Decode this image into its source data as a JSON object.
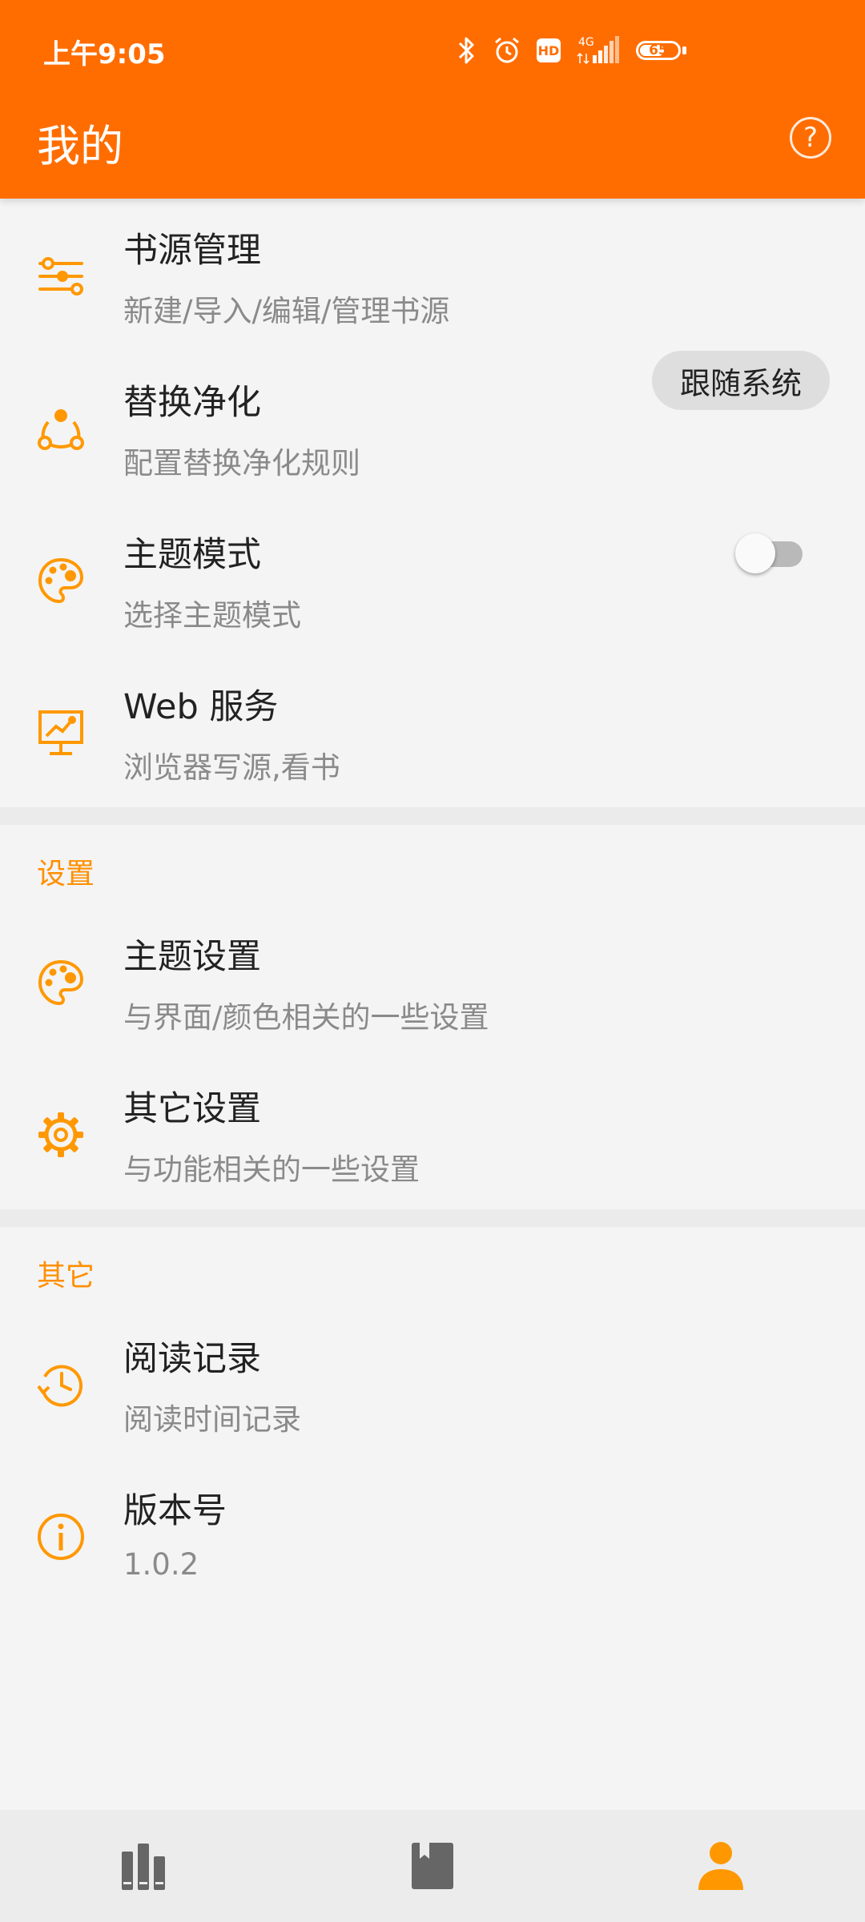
{
  "status_bar": {
    "time": "上午9:05",
    "hd": "HD",
    "network": "4G",
    "battery": "65"
  },
  "app_bar": {
    "title": "我的",
    "help_icon": "help-circle-icon"
  },
  "main_items": [
    {
      "title": "书源管理",
      "summary": "新建/导入/编辑/管理书源",
      "icon": "sliders-icon"
    },
    {
      "title": "替换净化",
      "summary": "配置替换净化规则",
      "icon": "share-triangle-icon"
    },
    {
      "title": "主题模式",
      "summary": "选择主题模式",
      "icon": "palette-icon"
    },
    {
      "title": "Web 服务",
      "summary": "浏览器写源,看书",
      "icon": "presentation-icon"
    }
  ],
  "theme_mode_value": "跟随系统",
  "web_service_enabled": false,
  "settings_section": {
    "header": "设置",
    "items": [
      {
        "title": "主题设置",
        "summary": "与界面/颜色相关的一些设置",
        "icon": "palette-icon"
      },
      {
        "title": "其它设置",
        "summary": "与功能相关的一些设置",
        "icon": "gear-icon"
      }
    ]
  },
  "other_section": {
    "header": "其它",
    "items": [
      {
        "title": "阅读记录",
        "summary": "阅读时间记录",
        "icon": "history-icon"
      },
      {
        "title": "版本号",
        "summary": "1.0.2",
        "icon": "info-icon"
      }
    ]
  },
  "bottom_nav": [
    {
      "icon": "bookshelf-icon",
      "active": false
    },
    {
      "icon": "bookmark-book-icon",
      "active": false
    },
    {
      "icon": "person-icon",
      "active": true
    }
  ],
  "colors": {
    "primary": "#ff6d00",
    "accent": "#ff8f00",
    "icon": "#ff9800",
    "nav_inactive": "#666666"
  }
}
